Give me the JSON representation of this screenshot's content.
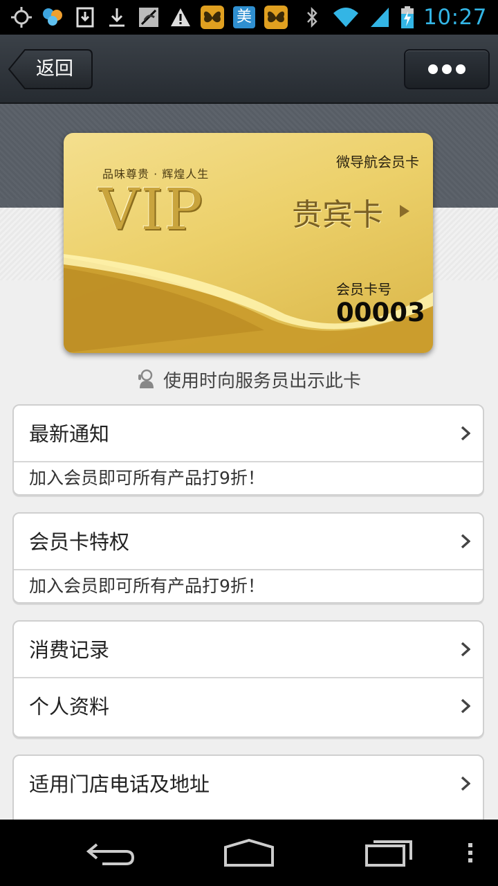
{
  "status_bar": {
    "time": "10:27",
    "left_icons": [
      "gps-icon",
      "weather-icon",
      "download-box-icon",
      "download-icon",
      "muted-sync-icon",
      "warning-icon",
      "butterfly-app-icon",
      "meituan-icon",
      "butterfly-app-icon-2"
    ],
    "meituan_char": "美",
    "right_icons": [
      "bluetooth-icon",
      "wifi-icon",
      "signal-icon",
      "battery-charging-icon"
    ]
  },
  "header": {
    "back_label": "返回",
    "more_icon": "more-dots-icon"
  },
  "card": {
    "slogan": "品味尊贵 · 辉煌人生",
    "vip": "VIP",
    "brand": "微导航会员卡",
    "type": "贵宾卡",
    "number_label": "会员卡号",
    "number": "00003"
  },
  "hint": {
    "text": "使用时向服务员出示此卡",
    "icon": "waiter-icon"
  },
  "groups": [
    {
      "title": "最新通知",
      "subtitle": " 加入会员即可所有产品打9折！"
    },
    {
      "title": "会员卡特权",
      "subtitle": "加入会员即可所有产品打9折！"
    },
    {
      "rows": [
        "消费记录",
        "个人资料"
      ]
    },
    {
      "rows": [
        "适用门店电话及地址"
      ]
    }
  ],
  "nav": {
    "back_icon": "nav-back-icon",
    "home_icon": "nav-home-icon",
    "recents_icon": "nav-recents-icon",
    "menu_icon": "nav-menu-icon"
  },
  "colors": {
    "time": "#33b5e5",
    "titlebar": "#2e343b",
    "card_gold": "#ecd06a"
  }
}
